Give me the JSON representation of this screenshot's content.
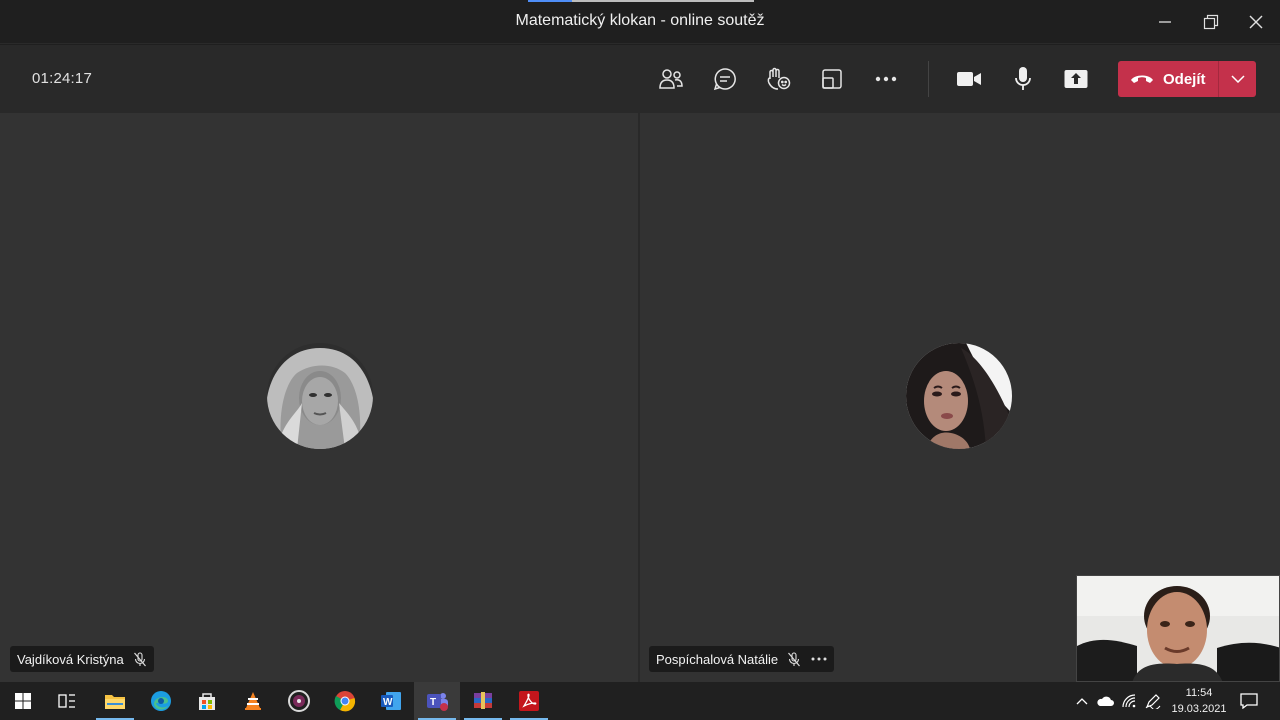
{
  "window": {
    "title": "Matematický klokan - online soutěž"
  },
  "meeting": {
    "timer": "01:24:17",
    "leave_label": "Odejít"
  },
  "participants": [
    {
      "name": "Vajdíková Kristýna",
      "muted": true
    },
    {
      "name": "Pospíchalová Natálie",
      "muted": true
    }
  ],
  "icons": {
    "toolbar": [
      "people-icon",
      "chat-icon",
      "raise-hand-icon",
      "share-tray-icon",
      "more-options-icon",
      "camera-icon",
      "microphone-icon",
      "share-screen-icon",
      "hang-up-icon",
      "chevron-down-icon"
    ],
    "taskbar": [
      "windows-start-icon",
      "task-view-icon",
      "file-explorer-icon",
      "edge-icon",
      "store-icon",
      "vlc-icon",
      "media-player-icon",
      "chrome-icon",
      "word-icon",
      "teams-icon",
      "winrar-icon",
      "acrobat-icon"
    ]
  },
  "colors": {
    "leave_button": "#c4314b",
    "toolbar_bg": "#292929",
    "tile_bg": "#333333",
    "taskbar_bg": "#202020"
  },
  "taskbar": {
    "time": "11:54",
    "date": "19.03.2021"
  }
}
